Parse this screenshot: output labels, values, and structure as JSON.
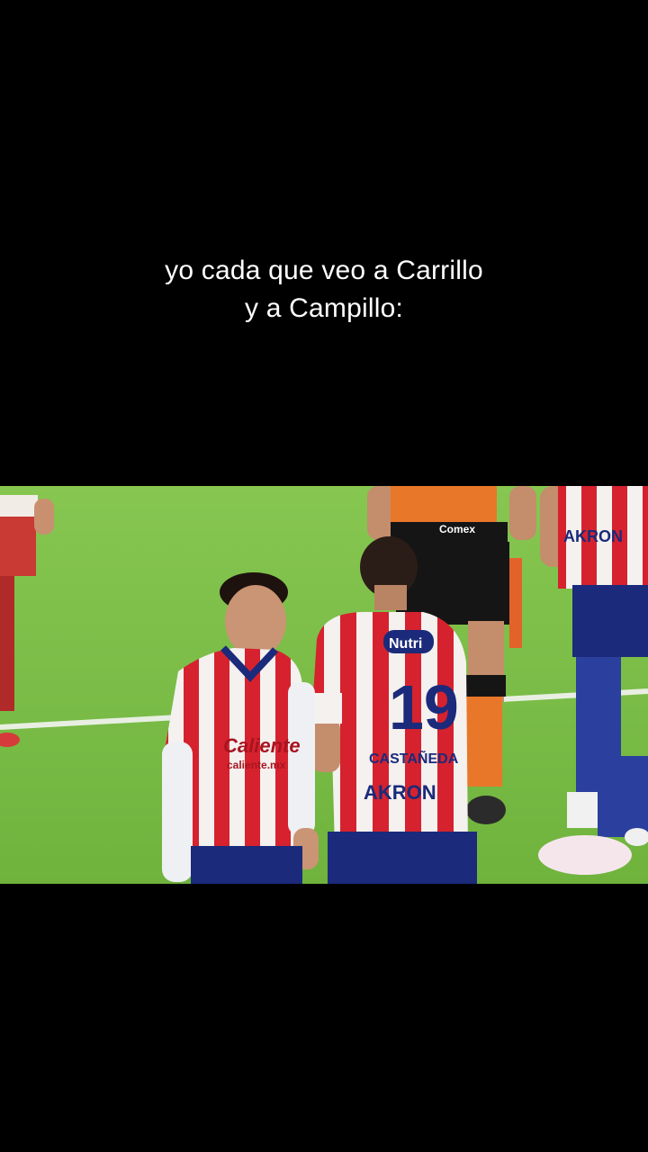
{
  "caption": {
    "line1": "yo cada que veo a Carrillo",
    "line2": "y a Campillo:"
  },
  "video": {
    "jersey_sponsor_front": "Caliente",
    "jersey_sponsor_front_small": "caliente.mx",
    "jersey_sponsor_back": "AKRON",
    "jersey_sponsor_top": "Nutri",
    "jersey_number": "19",
    "jersey_name": "CASTAÑEDA",
    "referee_sponsor": "Comex",
    "right_player_sponsor": "AKRON",
    "colors": {
      "pitch": "#79bd47",
      "jersey_red": "#d6222e",
      "jersey_white": "#f4f1ef",
      "shorts_navy": "#1b2a7a",
      "referee_orange": "#e9772a",
      "referee_black": "#151515"
    }
  }
}
